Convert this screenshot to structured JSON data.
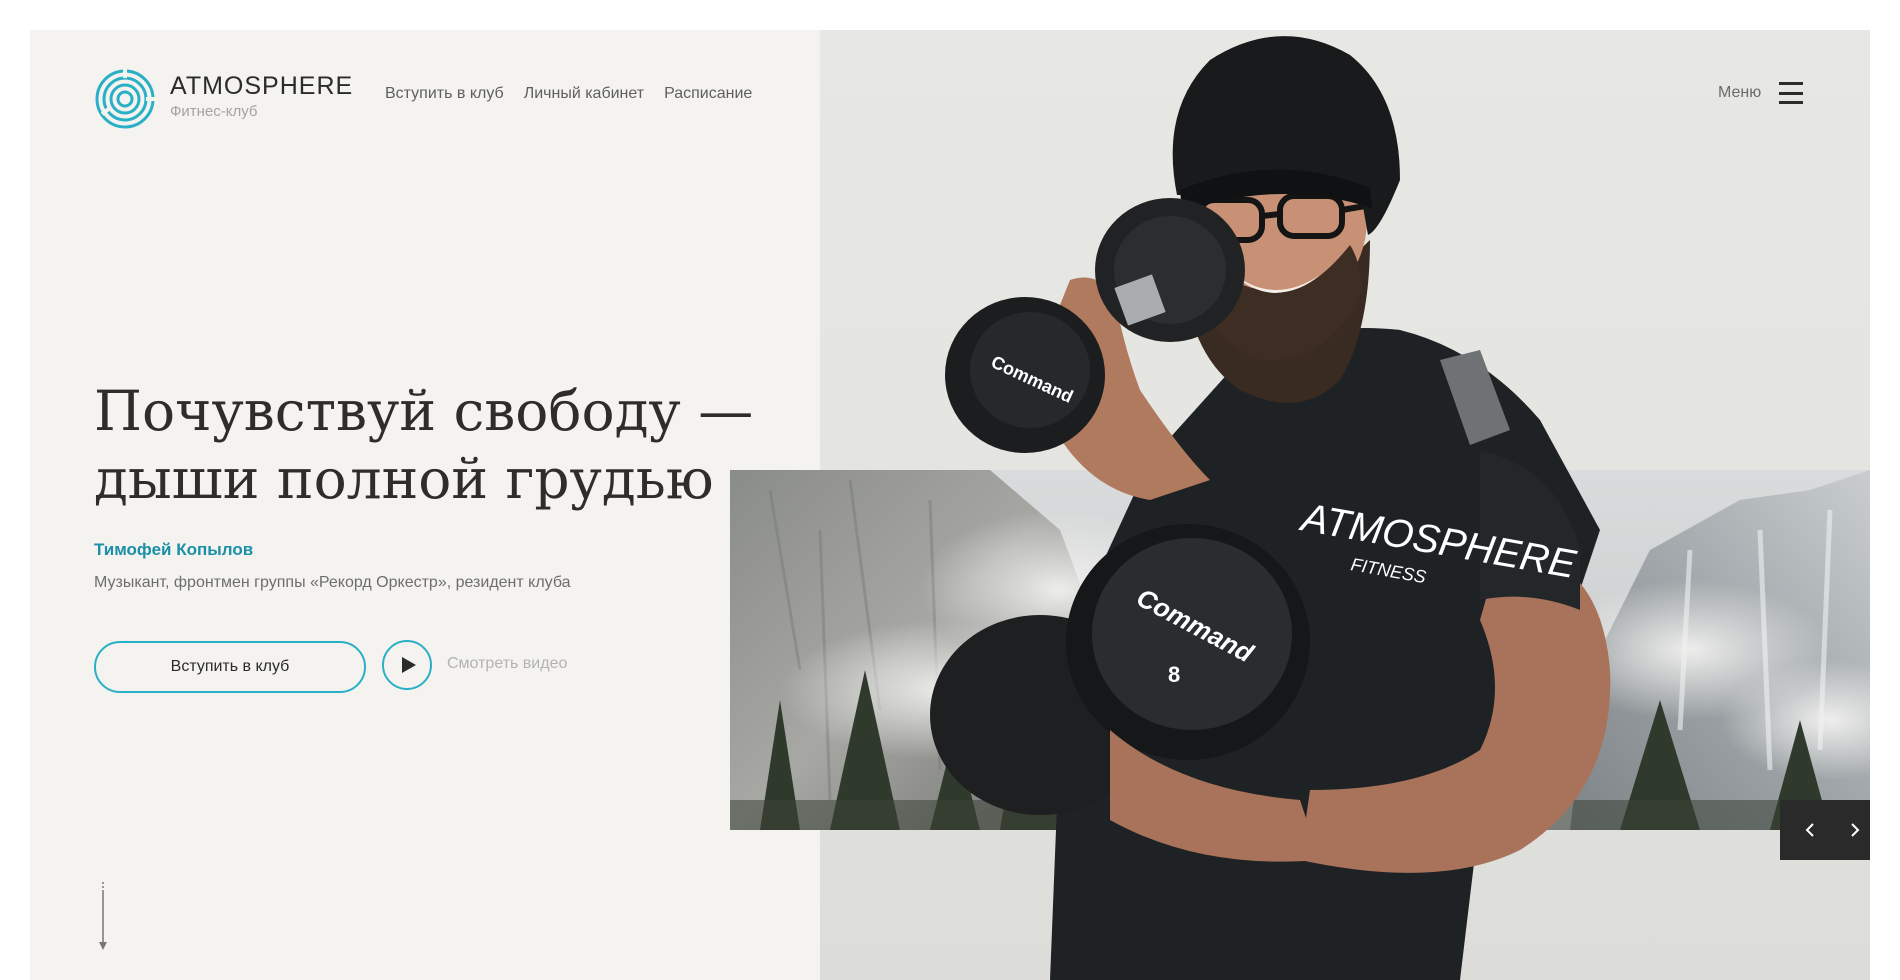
{
  "brand": {
    "name": "ATMOSPHERE",
    "subtitle": "Фитнес-клуб",
    "accent_color": "#2ab0c6"
  },
  "nav": {
    "items": [
      {
        "label": "Вступить в клуб"
      },
      {
        "label": "Личный кабинет"
      },
      {
        "label": "Расписание"
      }
    ]
  },
  "menu": {
    "label": "Меню",
    "icon": "hamburger-icon"
  },
  "hero": {
    "headline_line1": "Почувствуй свободу —",
    "headline_line2": "дыши полной грудью",
    "person_name": "Тимофей Копылов",
    "person_role": "Музыкант, фронтмен группы «Рекорд Оркестр», резидент клуба",
    "join_button": "Вступить в клуб",
    "video_label": "Смотреть видео",
    "play_icon": "play-icon",
    "scroll_icon": "scroll-down-arrow-icon"
  },
  "photo": {
    "shirt_line1": "ATMOSPHERE",
    "shirt_line2": "FITNESS",
    "dumbbell_brand": "Command",
    "dumbbell_weight": "8"
  },
  "slider": {
    "prev_icon": "chevron-left-icon",
    "next_icon": "chevron-right-icon"
  }
}
